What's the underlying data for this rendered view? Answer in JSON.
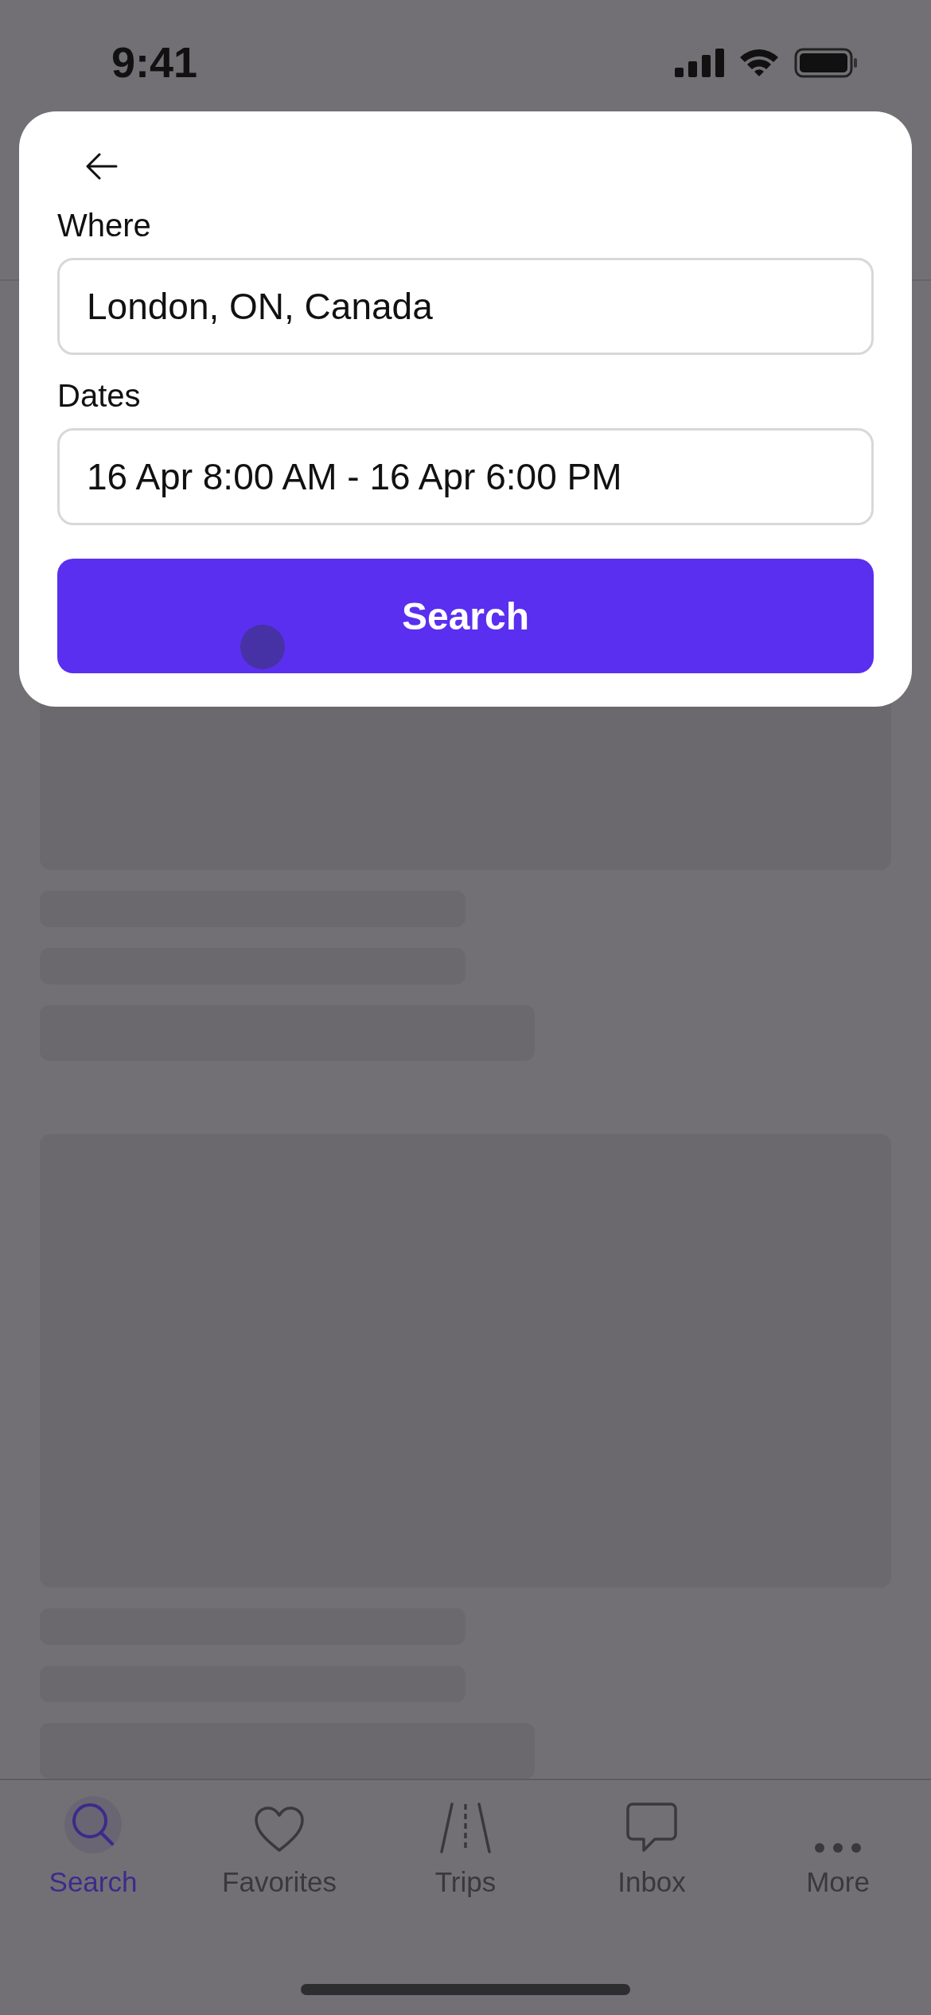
{
  "status_bar": {
    "time": "9:41"
  },
  "search_panel": {
    "fields": [
      {
        "label": "Where",
        "value": "London, ON, Canada"
      },
      {
        "label": "Dates",
        "value": "16 Apr 8:00 AM - 16 Apr 6:00 PM"
      }
    ],
    "search_button": "Search"
  },
  "tab_bar": [
    {
      "kind": "search",
      "label": "Search",
      "selected": true
    },
    {
      "kind": "favorites",
      "label": "Favorites",
      "selected": false
    },
    {
      "kind": "trips",
      "label": "Trips",
      "selected": false
    },
    {
      "kind": "inbox",
      "label": "Inbox",
      "selected": false
    },
    {
      "kind": "more",
      "label": "More",
      "selected": false
    }
  ]
}
